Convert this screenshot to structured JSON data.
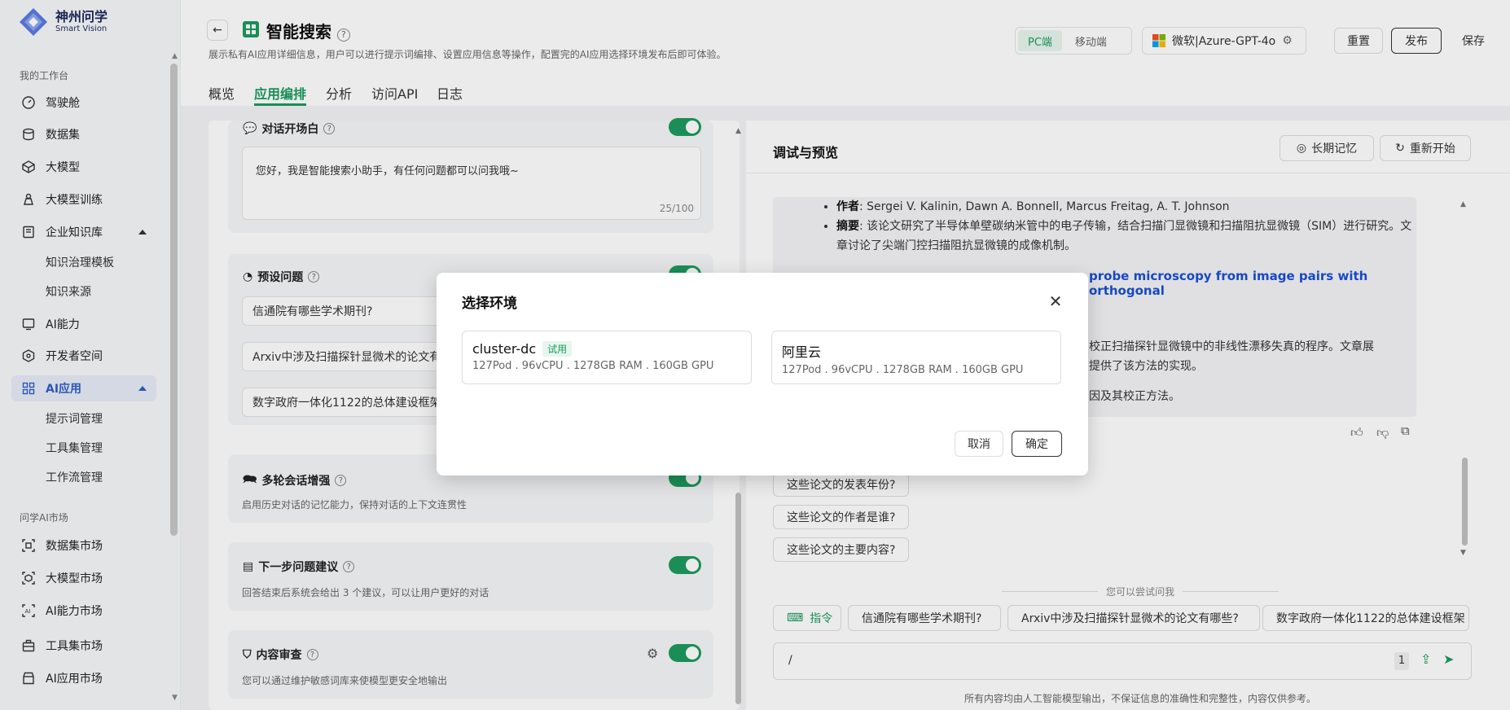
{
  "brand": {
    "name": "神州问学",
    "sub": "Smart Vision"
  },
  "sidebar": {
    "section1": "我的工作台",
    "items": [
      {
        "label": "驾驶舱",
        "icon": "dashboard-icon"
      },
      {
        "label": "数据集",
        "icon": "database-icon"
      },
      {
        "label": "大模型",
        "icon": "cube-icon"
      },
      {
        "label": "大模型训练",
        "icon": "training-icon"
      },
      {
        "label": "企业知识库",
        "icon": "book-icon"
      },
      {
        "label": "AI能力",
        "icon": "ai-ability-icon"
      },
      {
        "label": "开发者空间",
        "icon": "developer-icon"
      },
      {
        "label": "AI应用",
        "icon": "grid-apps-icon"
      }
    ],
    "kb_sub": [
      "知识治理模板",
      "知识来源"
    ],
    "app_sub": [
      "提示词管理",
      "工具集管理",
      "工作流管理"
    ],
    "section2": "问学AI市场",
    "market": [
      {
        "label": "数据集市场",
        "icon": "dataset-market-icon"
      },
      {
        "label": "大模型市场",
        "icon": "model-market-icon"
      },
      {
        "label": "AI能力市场",
        "icon": "ai-market-icon"
      },
      {
        "label": "工具集市场",
        "icon": "toolbox-market-icon"
      },
      {
        "label": "AI应用市场",
        "icon": "app-market-icon"
      }
    ]
  },
  "header": {
    "title": "智能搜索",
    "description": "展示私有AI应用详细信息，用户可以进行提示词编排、设置应用信息等操作，配置完的AI应用选择环境发布后即可体验。",
    "tabs": [
      "概览",
      "应用编排",
      "分析",
      "访问API",
      "日志"
    ],
    "pc": "PC端",
    "mobile": "移动端",
    "model": "微软|Azure-GPT-4o",
    "reset": "重置",
    "publish": "发布",
    "save": "保存"
  },
  "left": {
    "opening_title": "对话开场白",
    "opening_text": "您好，我是智能搜索小助手，有任何问题都可以问我哦~",
    "opening_count": "25/100",
    "preset_title": "预设问题",
    "presets": [
      "信通院有哪些学术期刊?",
      "Arxiv中涉及扫描探针显微术的论文有",
      "数字政府一体化1122的总体建设框架"
    ],
    "multi_title": "多轮会话增强",
    "multi_desc": "启用历史对话的记忆能力，保持对话的上下文连贯性",
    "next_title": "下一步问题建议",
    "next_desc": "回答结束后系统会给出 3 个建议，可以让用户更好的对话",
    "review_title": "内容审查",
    "review_desc": "您可以通过维护敏感词库来使模型更安全地输出"
  },
  "right": {
    "title": "调试与预览",
    "memory": "长期记忆",
    "restart": "重新开始",
    "msg": {
      "author_label": "作者",
      "author": ": Sergei V. Kalinin, Dawn A. Bonnell, Marcus Freitag, A. T. Johnson",
      "abstract_label": "摘要",
      "abstract": ": 该论文研究了半导体单壁碳纳米管中的电子传输，结合扫描门显微镜和扫描阻抗显微镜（SIM）进行研究。文章讨论了尖端门控扫描阻抗显微镜的成像机制。",
      "link": "probe microscopy from image pairs with orthogonal",
      "p2_line1": "校正扫描探针显微镜中的非线性漂移失真的程序。文章展",
      "p2_line2": "提供了该方法的实现。",
      "p3": "因及其校正方法。"
    },
    "followups": [
      "这些论文的发表年份?",
      "这些论文的作者是谁?",
      "这些论文的主要内容?"
    ],
    "try_label": "您可以尝试问我",
    "cmd": "指令",
    "suggestions": [
      "信通院有哪些学术期刊?",
      "Arxiv中涉及扫描探针显微术的论文有哪些?",
      "数字政府一体化1122的总体建设框架"
    ],
    "input_value": "/",
    "input_count": "1",
    "footer": "所有内容均由人工智能模型输出，不保证信息的准确性和完整性，内容仅供参考。"
  },
  "modal": {
    "title": "选择环境",
    "envs": [
      {
        "name": "cluster-dc",
        "badge": "试用",
        "spec": "127Pod . 96vCPU . 1278GB RAM . 160GB GPU"
      },
      {
        "name": "阿里云",
        "spec": "127Pod . 96vCPU . 1278GB RAM . 160GB GPU"
      }
    ],
    "cancel": "取消",
    "confirm": "确定"
  },
  "colors": {
    "accent": "#1d9b5e",
    "active_nav": "#2f5ec8",
    "link": "#1a4fd6"
  }
}
